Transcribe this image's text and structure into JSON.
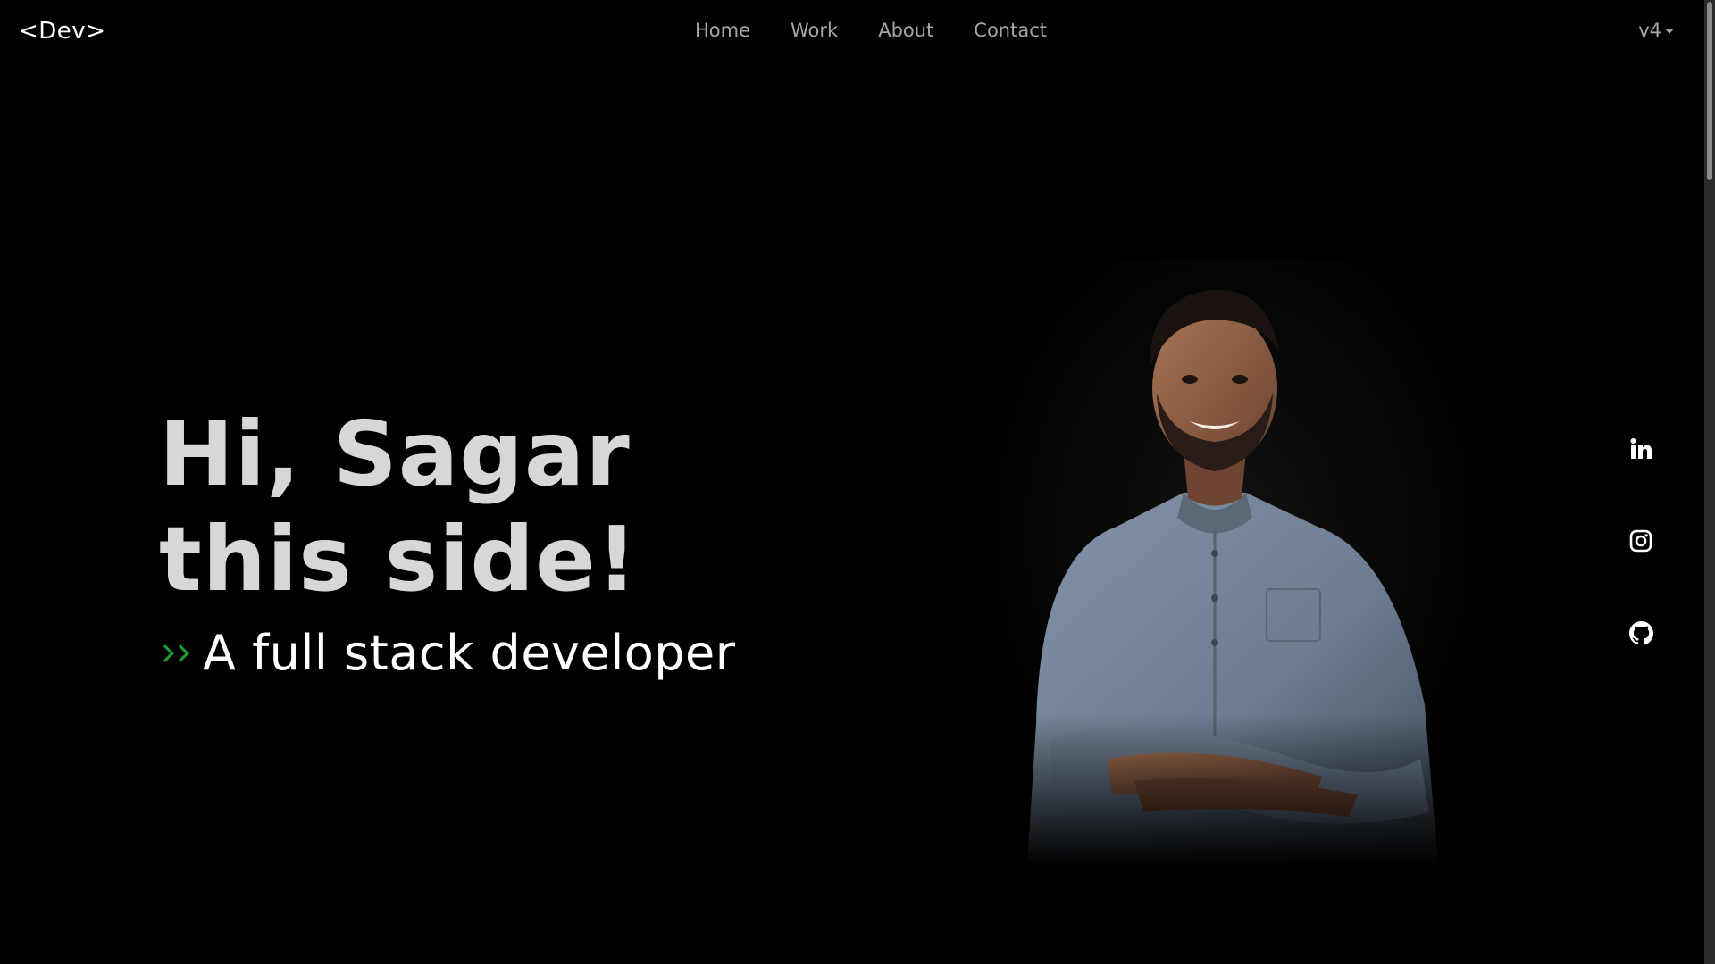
{
  "navbar": {
    "logo": "<Dev>",
    "links": [
      "Home",
      "Work",
      "About",
      "Contact"
    ],
    "version": "v4"
  },
  "hero": {
    "line1": "Hi, Sagar",
    "line2": "this side!",
    "tagline": "A full stack developer"
  },
  "social": {
    "icons": [
      "linkedin-icon",
      "instagram-icon",
      "github-icon"
    ]
  },
  "colors": {
    "background": "#000000",
    "title": "#d7d7d9",
    "accent": "#1f9e34",
    "nav_text": "#a6a6a6"
  }
}
